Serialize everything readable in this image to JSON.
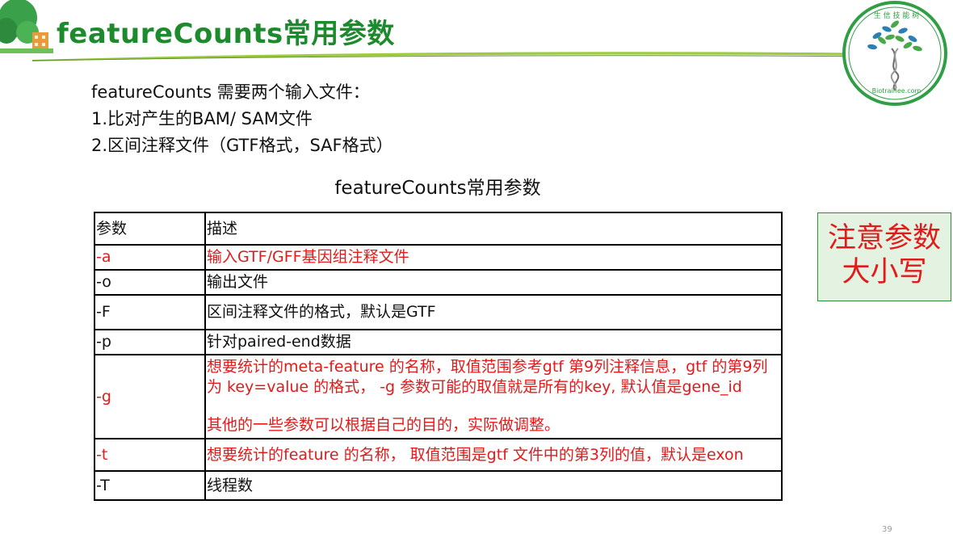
{
  "title": "featureCounts常用参数",
  "logo": {
    "top_text": "生 信 技 能 树",
    "bottom_text": "Biotrainee.com",
    "brand_color": "#2f9e44"
  },
  "intro": {
    "line1": "featureCounts 需要两个输入文件：",
    "line2": "1.比对产生的BAM/ SAM文件",
    "line3": "2.区间注释文件（GTF格式，SAF格式）"
  },
  "table": {
    "caption": "featureCounts常用参数",
    "headers": [
      "参数",
      "描述"
    ],
    "rows": [
      {
        "param": "-a",
        "desc": "输入GTF/GFF基因组注释文件"
      },
      {
        "param": "-o",
        "desc": "输出文件"
      },
      {
        "param": "-F",
        "desc": "区间注释文件的格式，默认是GTF"
      },
      {
        "param": "-p",
        "desc": "针对paired-end数据"
      },
      {
        "param": "-g",
        "desc": "想要统计的meta-feature 的名称，取值范围参考gtf 第9列注释信息，gtf 的第9列为 key=value 的格式， -g 参数可能的取值就是所有的key, 默认值是gene_id",
        "desc2": "其他的一些参数可以根据自己的目的，实际做调整。"
      },
      {
        "param": "-t",
        "desc": "想要统计的feature 的名称， 取值范围是gtf 文件中的第3列的值，默认是exon"
      },
      {
        "param": "-T",
        "desc": "线程数"
      }
    ]
  },
  "note": {
    "line1": "注意参数",
    "line2": "大小写"
  },
  "page_number": "39",
  "colors": {
    "title_green": "#1e8a2e",
    "highlight_red": "#e21a1a",
    "note_bg": "#e3f2e1"
  }
}
